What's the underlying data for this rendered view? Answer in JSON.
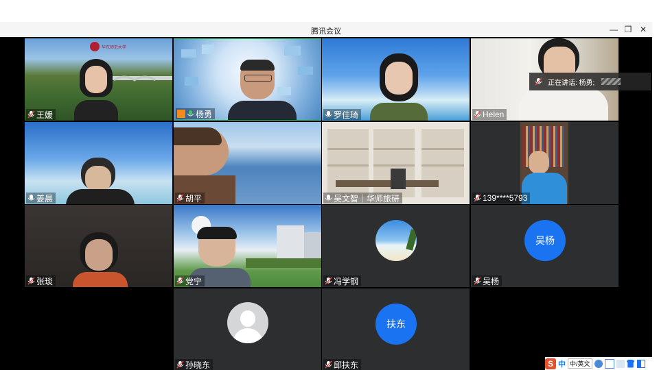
{
  "window": {
    "title": "腾讯会议",
    "min": "—",
    "restore": "❐",
    "close": "✕"
  },
  "speaking": {
    "prefix": "正在讲话: 杨勇;"
  },
  "participants": [
    {
      "name": "王媛"
    },
    {
      "name": "杨勇"
    },
    {
      "name": "罗佳琦"
    },
    {
      "name": "Helen"
    },
    {
      "name": "姜晨"
    },
    {
      "name": "胡平"
    },
    {
      "name": "吴文智｜华师旅研"
    },
    {
      "name": "139****5793"
    },
    {
      "name": "张琰"
    },
    {
      "name": "党宁"
    },
    {
      "name": "冯学钢"
    },
    {
      "name": "吴杨",
      "avatar_text": "吴杨"
    },
    {
      "name": "孙晓东"
    },
    {
      "name": "邱扶东",
      "avatar_text": "扶东"
    }
  ],
  "taskbar": {
    "ime": "中",
    "ime_mode": "中/英文"
  },
  "colors": {
    "avatar_blue": "#1a73f0",
    "tile_dark": "#2d2e30",
    "mic_muted": "#e25050"
  }
}
